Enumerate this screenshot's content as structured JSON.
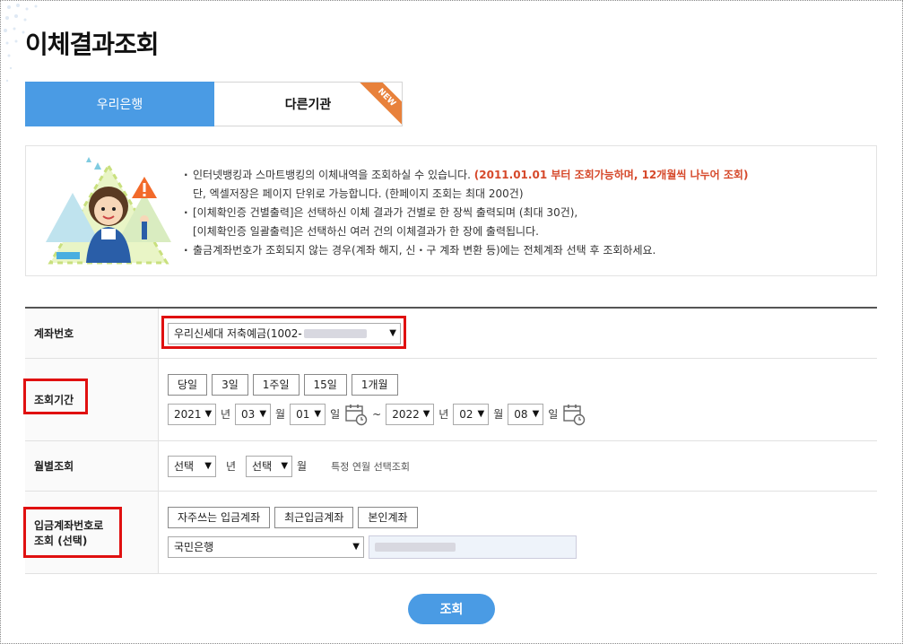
{
  "page": {
    "title": "이체결과조회"
  },
  "tabs": [
    {
      "label": "우리은행",
      "active": true
    },
    {
      "label": "다른기관",
      "active": false,
      "badge": "NEW"
    }
  ],
  "notice": {
    "line1": "인터넷뱅킹과 스마트뱅킹의 이체내역을 조회하실 수 있습니다.",
    "line1_highlight": "(2011.01.01 부터 조회가능하며, 12개월씩 나누어 조회)",
    "line2": "단, 엑셀저장은 페이지 단위로 가능합니다. (한페이지 조회는 최대 200건)",
    "line3": "[이체확인증 건별출력]은 선택하신 이체 결과가 건별로 한 장씩 출력되며 (최대 30건),",
    "line4": "[이체확인증 일괄출력]은 선택하신 여러 건의 이체결과가 한 장에 출력됩니다.",
    "line5": "출금계좌번호가 조회되지 않는 경우(계좌 해지, 신・구 계좌 변환 등)에는 전체계좌 선택 후 조회하세요."
  },
  "form": {
    "account": {
      "label": "계좌번호",
      "selected": "우리신세대 저축예금(1002-"
    },
    "period": {
      "label": "조회기간",
      "quick_buttons": [
        "당일",
        "3일",
        "1주일",
        "15일",
        "1개월"
      ],
      "start": {
        "year": "2021",
        "month": "03",
        "day": "01"
      },
      "end": {
        "year": "2022",
        "month": "02",
        "day": "08"
      },
      "year_unit": "년",
      "month_unit": "월",
      "day_unit": "일",
      "separator": "~"
    },
    "monthly": {
      "label": "월별조회",
      "year_select": "선택",
      "month_select": "선택",
      "year_unit": "년",
      "month_unit": "월",
      "note": "특정 연월 선택조회"
    },
    "deposit": {
      "label_line1": "입금계좌번호로",
      "label_line2": "조회 (선택)",
      "buttons": [
        "자주쓰는 입금계좌",
        "최근입금계좌",
        "본인계좌"
      ],
      "bank_selected": "국민은행"
    }
  },
  "actions": {
    "search_label": "조회"
  },
  "colors": {
    "accent": "#4a9be4",
    "highlight": "#d6492b",
    "ribbon": "#e8813b",
    "annotation": "#e01010"
  },
  "icons": {
    "calendar": "calendar-icon",
    "caret": "chevron-down-icon",
    "warning": "warning-icon"
  }
}
